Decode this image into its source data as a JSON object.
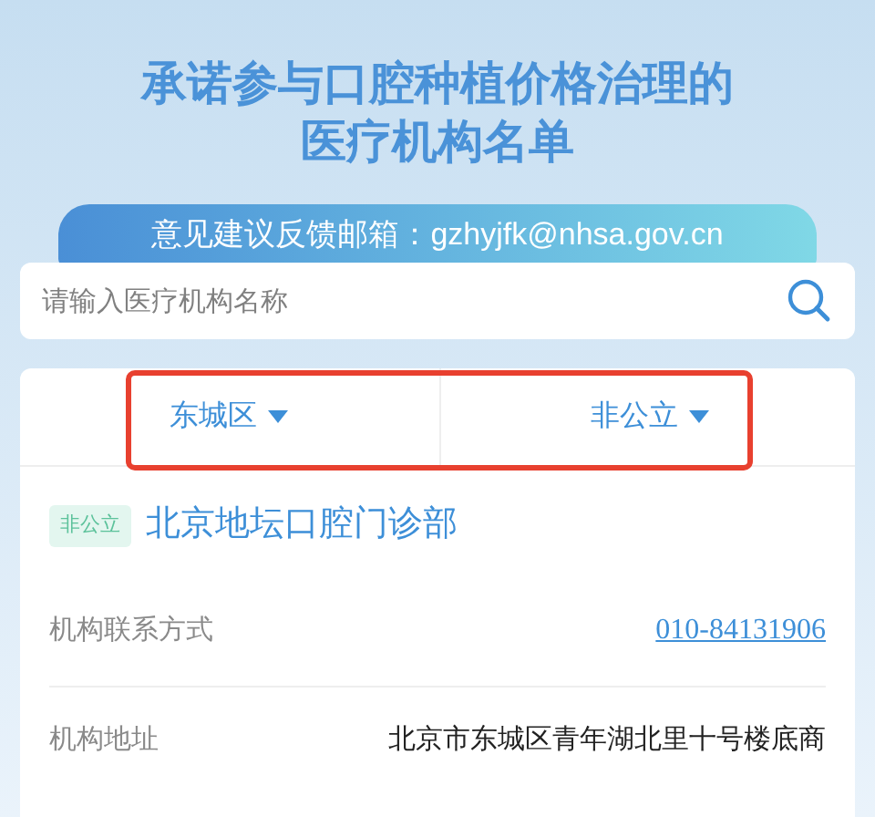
{
  "header": {
    "title_lines": [
      "承诺参与口腔种植价格治理的",
      "医疗机构名单"
    ],
    "feedback": "意见建议反馈邮箱：gzhyjfk@nhsa.gov.cn"
  },
  "search": {
    "placeholder": "请输入医疗机构名称"
  },
  "filter_bar": {
    "highlighted": true,
    "filters": [
      {
        "label": "东城区"
      },
      {
        "label": "非公立"
      }
    ]
  },
  "institution": {
    "tag": "非公立",
    "name": "北京地坛口腔门诊部",
    "fields": [
      {
        "kind": "link",
        "label": "机构联系方式",
        "value": "010-84131906"
      },
      {
        "kind": "text",
        "label": "机构地址",
        "value": "北京市东城区青年湖北里十号楼底商"
      }
    ]
  }
}
